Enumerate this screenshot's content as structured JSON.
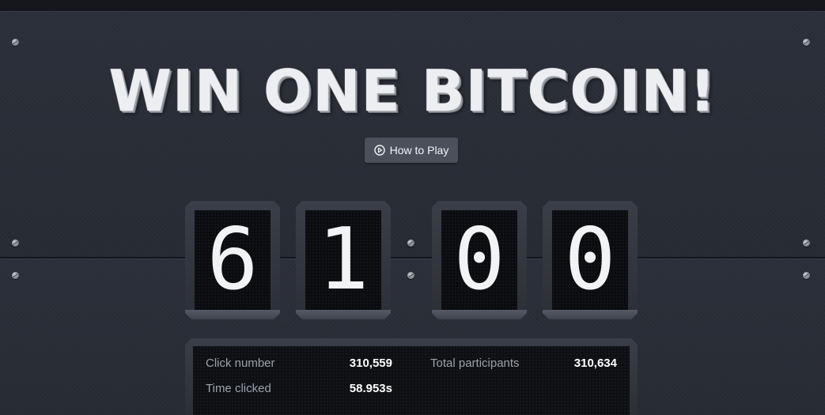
{
  "title": "WIN ONE BITCOIN!",
  "how_to_play": {
    "label": "How to Play",
    "icon": "play-circle-icon"
  },
  "counter": {
    "digits": [
      "6",
      "1",
      "0",
      "0"
    ]
  },
  "stats": {
    "click_number_label": "Click number",
    "click_number_value": "310,559",
    "time_clicked_label": "Time clicked",
    "time_clicked_value": "58.953s",
    "total_participants_label": "Total participants",
    "total_participants_value": "310,634"
  },
  "colors": {
    "background": "#272b34",
    "button": "#4b505b",
    "digit_bg": "#0b0c10",
    "title_text": "#eceef1"
  }
}
